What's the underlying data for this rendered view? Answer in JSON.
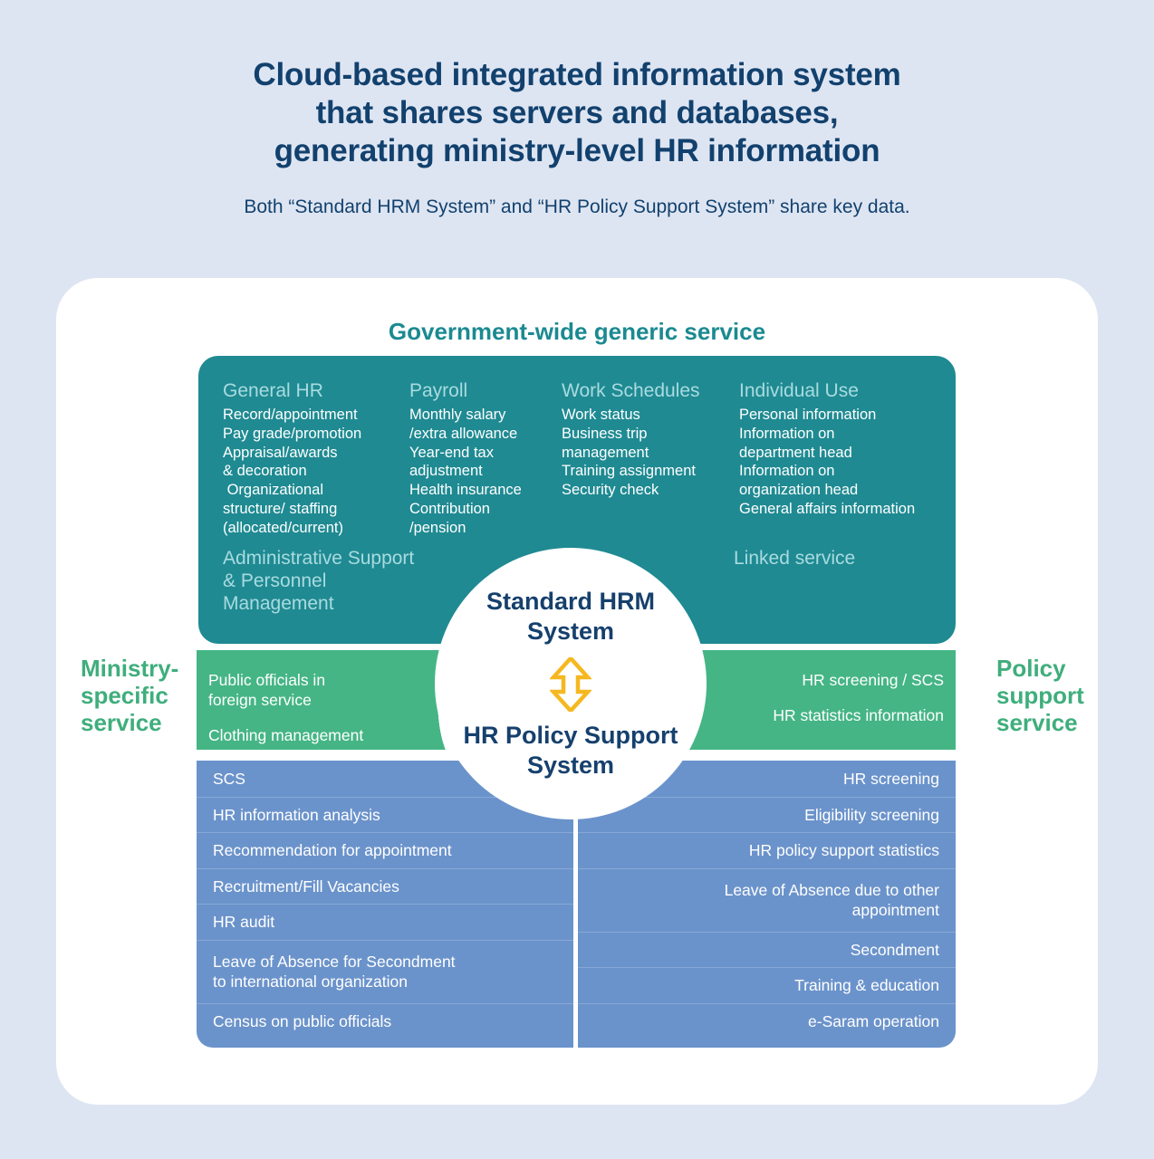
{
  "header": {
    "title_lines": [
      "Cloud-based integrated information system",
      "that shares servers and databases,",
      "generating ministry-level HR information"
    ],
    "subtitle": "Both “Standard HRM System” and “HR Policy Support System” share key data."
  },
  "colors": {
    "background": "#dee5f2",
    "card": "#ffffff",
    "teal": "#1f8a92",
    "teal_heading": "#a9dbe0",
    "green": "#45b585",
    "green_label": "#3fae7c",
    "blue": "#6b93cb",
    "blue_divider": "#86a8d6",
    "navy_text": "#12416e",
    "arrow": "#f5b820"
  },
  "generic_service": {
    "label": "Government-wide generic service",
    "columns": [
      {
        "heading": "General HR",
        "items": "Record/appointment\nPay grade/promotion\nAppraisal/awards\n& decoration\n Organizational\nstructure/ staffing\n(allocated/current)"
      },
      {
        "heading": "Payroll",
        "items": "Monthly salary\n/extra allowance\nYear-end tax\nadjustment\nHealth insurance\nContribution\n/pension"
      },
      {
        "heading": "Work Schedules",
        "items": "Work status\nBusiness trip\nmanagement\nTraining assignment\nSecurity check"
      },
      {
        "heading": "Individual Use",
        "items": "Personal information\nInformation on\ndepartment head\nInformation on\norganization head\nGeneral affairs information"
      }
    ],
    "sub_left": "Administrative Support\n& Personnel\nManagement",
    "sub_right": "Linked service"
  },
  "ministry_specific": {
    "side_label": "Ministry-\nspecific\nservice",
    "band_line1": "Public officials in\nforeign service",
    "band_line2": "Clothing management",
    "rows": [
      {
        "label": "SCS",
        "height": "h1"
      },
      {
        "label": "HR information analysis",
        "height": "h1"
      },
      {
        "label": "Recommendation for appointment",
        "height": "h1"
      },
      {
        "label": "Recruitment/Fill Vacancies",
        "height": "h1"
      },
      {
        "label": "HR audit",
        "height": "h1"
      },
      {
        "label": "Leave of Absence for Secondment\nto international organization",
        "height": "h2"
      },
      {
        "label": "Census on public officials",
        "height": "h1"
      }
    ]
  },
  "policy_support": {
    "side_label": "Policy\nsupport\nservice",
    "band_line1": "HR screening / SCS",
    "band_line2": "HR statistics information",
    "rows": [
      {
        "label": "HR screening",
        "height": "h1"
      },
      {
        "label": "Eligibility screening",
        "height": "h1"
      },
      {
        "label": "HR policy support statistics",
        "height": "h1"
      },
      {
        "label": "Leave of Absence due to other\nappointment",
        "height": "h2"
      },
      {
        "label": "Secondment",
        "height": "h1"
      },
      {
        "label": "Training & education",
        "height": "h1"
      },
      {
        "label": "e-Saram operation",
        "height": "h1"
      }
    ]
  },
  "center": {
    "top_title": "Standard HRM\nSystem",
    "bottom_title": "HR Policy Support\nSystem",
    "arrow_icon": "double-arrow-vertical-icon"
  }
}
